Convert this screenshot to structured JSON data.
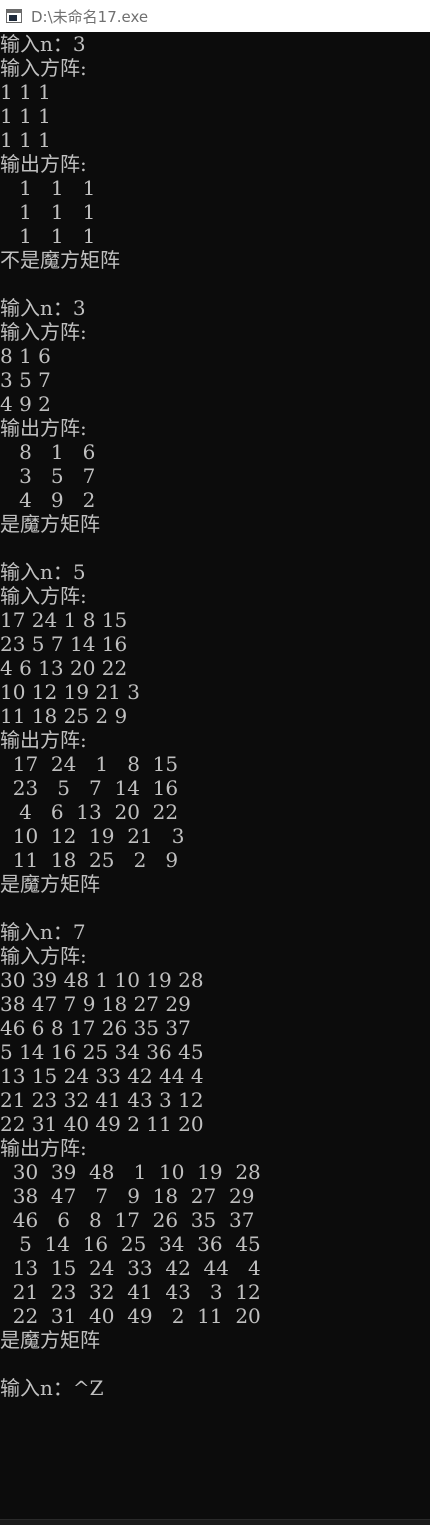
{
  "window": {
    "title": "D:\\未命名17.exe",
    "icon": "console-window-icon"
  },
  "console": {
    "lines": [
      "输入n：3",
      "输入方阵:",
      "1 1 1",
      "1 1 1",
      "1 1 1",
      "输出方阵:",
      "   1   1   1",
      "   1   1   1",
      "   1   1   1",
      "不是魔方矩阵",
      "",
      "输入n：3",
      "输入方阵:",
      "8 1 6",
      "3 5 7",
      "4 9 2",
      "输出方阵:",
      "   8   1   6",
      "   3   5   7",
      "   4   9   2",
      "是魔方矩阵",
      "",
      "输入n：5",
      "输入方阵:",
      "17 24 1 8 15",
      "23 5 7 14 16",
      "4 6 13 20 22",
      "10 12 19 21 3",
      "11 18 25 2 9",
      "输出方阵:",
      "  17  24   1   8  15",
      "  23   5   7  14  16",
      "   4   6  13  20  22",
      "  10  12  19  21   3",
      "  11  18  25   2   9",
      "是魔方矩阵",
      "",
      "输入n：7",
      "输入方阵:",
      "30 39 48 1 10 19 28",
      "38 47 7 9 18 27 29",
      "46 6 8 17 26 35 37",
      "5 14 16 25 34 36 45",
      "13 15 24 33 42 44 4",
      "21 23 32 41 43 3 12",
      "22 31 40 49 2 11 20",
      "输出方阵:",
      "  30  39  48   1  10  19  28",
      "  38  47   7   9  18  27  29",
      "  46   6   8  17  26  35  37",
      "   5  14  16  25  34  36  45",
      "  13  15  24  33  42  44   4",
      "  21  23  32  41  43   3  12",
      "  22  31  40  49   2  11  20",
      "是魔方矩阵",
      "",
      "输入n：^Z"
    ]
  },
  "colors": {
    "background": "#0c0c0c",
    "text": "#c0c0c0",
    "titlebar": "#ffffff",
    "title_text": "#707070"
  }
}
